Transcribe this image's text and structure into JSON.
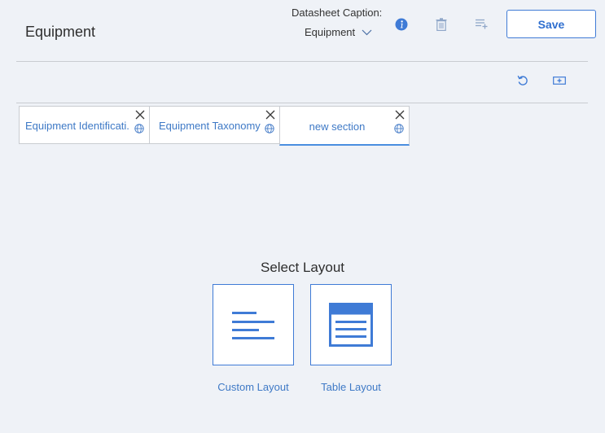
{
  "header": {
    "title": "Equipment",
    "caption_label": "Datasheet Caption:",
    "caption_value": "Equipment",
    "save_label": "Save"
  },
  "toolbar": {
    "icons": [
      "info-icon",
      "trash-icon",
      "add-list-icon"
    ],
    "secondary_icons": [
      "undo-icon",
      "add-section-icon"
    ]
  },
  "tabs": [
    {
      "label": "Equipment Identificati...",
      "active": false
    },
    {
      "label": "Equipment Taxonomy",
      "active": false
    },
    {
      "label": "new section",
      "active": true
    }
  ],
  "layout_selector": {
    "title": "Select Layout",
    "options": [
      {
        "label": "Custom Layout",
        "icon": "custom-layout-icon"
      },
      {
        "label": "Table Layout",
        "icon": "table-layout-icon"
      }
    ]
  },
  "colors": {
    "accent": "#3f7bd6",
    "background": "#eff2f7",
    "divider": "#c9ccd1"
  }
}
